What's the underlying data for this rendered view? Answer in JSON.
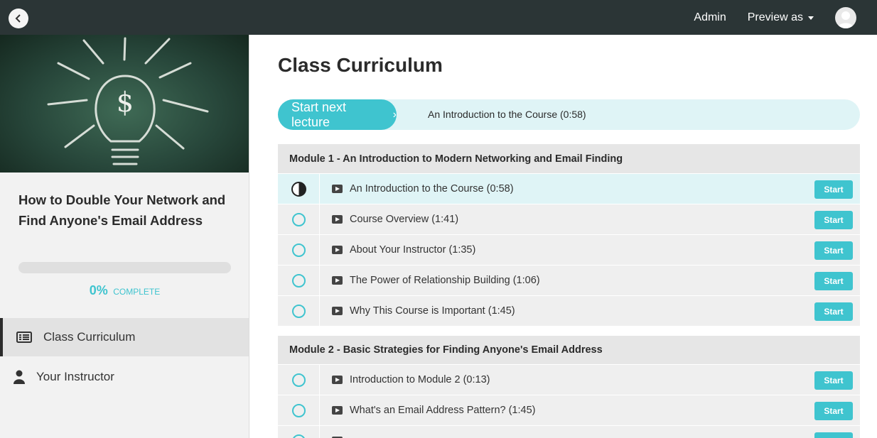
{
  "topbar": {
    "admin_label": "Admin",
    "preview_label": "Preview as"
  },
  "sidebar": {
    "course_title": "How to Double Your Network and Find Anyone's Email Address",
    "progress": {
      "percent": 0,
      "percent_text": "0%",
      "label": "COMPLETE"
    },
    "items": [
      {
        "label": "Class Curriculum",
        "icon": "list-icon",
        "active": true
      },
      {
        "label": "Your Instructor",
        "icon": "user-icon",
        "active": false
      }
    ]
  },
  "main": {
    "title": "Class Curriculum",
    "next_lecture": {
      "button_label": "Start next lecture",
      "lecture_title": "An Introduction to the Course (0:58)"
    },
    "start_label": "Start",
    "modules": [
      {
        "title": "Module 1 - An Introduction to Modern Networking and Email Finding",
        "lectures": [
          {
            "title": "An Introduction to the Course (0:58)",
            "status": "in-progress"
          },
          {
            "title": "Course Overview (1:41)",
            "status": "not-started"
          },
          {
            "title": "About Your Instructor (1:35)",
            "status": "not-started"
          },
          {
            "title": "The Power of Relationship Building (1:06)",
            "status": "not-started"
          },
          {
            "title": "Why This Course is Important (1:45)",
            "status": "not-started"
          }
        ]
      },
      {
        "title": "Module 2 - Basic Strategies for Finding Anyone's Email Address",
        "lectures": [
          {
            "title": "Introduction to Module 2 (0:13)",
            "status": "not-started"
          },
          {
            "title": "What's an Email Address Pattern? (1:45)",
            "status": "not-started"
          },
          {
            "title": "",
            "status": "not-started"
          }
        ]
      }
    ]
  },
  "colors": {
    "accent": "#3fc4cf",
    "topbar": "#2b3536",
    "current_row": "#dff4f6"
  }
}
